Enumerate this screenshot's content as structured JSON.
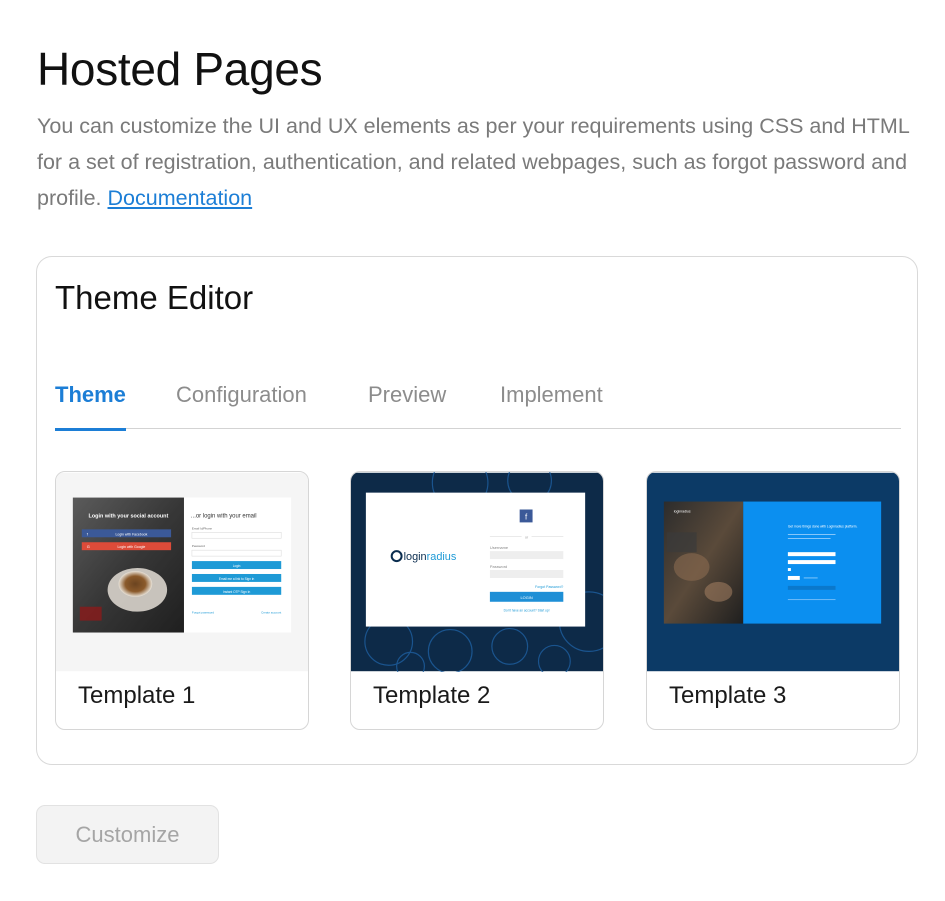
{
  "header": {
    "title": "Hosted Pages",
    "description": "You can customize the UI and UX elements as per your requirements using CSS and HTML for a set of registration, authentication, and related webpages, such as forgot password and profile. ",
    "doc_link": "Documentation"
  },
  "editor": {
    "title": "Theme Editor",
    "tabs": [
      {
        "label": "Theme",
        "active": true
      },
      {
        "label": "Configuration",
        "active": false
      },
      {
        "label": "Preview",
        "active": false
      },
      {
        "label": "Implement",
        "active": false
      }
    ],
    "templates": [
      {
        "label": "Template 1",
        "preview": {
          "social_heading": "Login with your social account",
          "facebook_btn": "Login with Facebook",
          "google_btn": "Login with Google",
          "email_heading": "...or login with your email",
          "email_label": "Email Id/Phone",
          "password_label": "Password",
          "login_btn": "Login",
          "email_link_btn": "Email me a link to Sign in",
          "otp_btn": "Instant OTP Sign In",
          "forgot_link": "Forgot password",
          "create_link": "Create account"
        }
      },
      {
        "label": "Template 2",
        "preview": {
          "logo_text_a": "login",
          "logo_text_b": "radius",
          "fb_letter": "f",
          "or_text": "or",
          "username_label": "Username",
          "password_label": "Password",
          "forgot_text": "Forgot Password?",
          "login_btn": "LOGIN",
          "register_text": "Don't have an account? Start up!"
        }
      },
      {
        "label": "Template 3",
        "preview": {
          "logo_text": "loginradius",
          "heading": "Get more things done with Loginradius platform."
        }
      }
    ]
  },
  "actions": {
    "customize_label": "Customize"
  },
  "colors": {
    "accent": "#1c7ed6",
    "muted_text": "#7a7a7a",
    "template2_bg": "#0d2a48",
    "template3_bg": "#0c3a66",
    "template3_panel": "#0b8ff0"
  }
}
